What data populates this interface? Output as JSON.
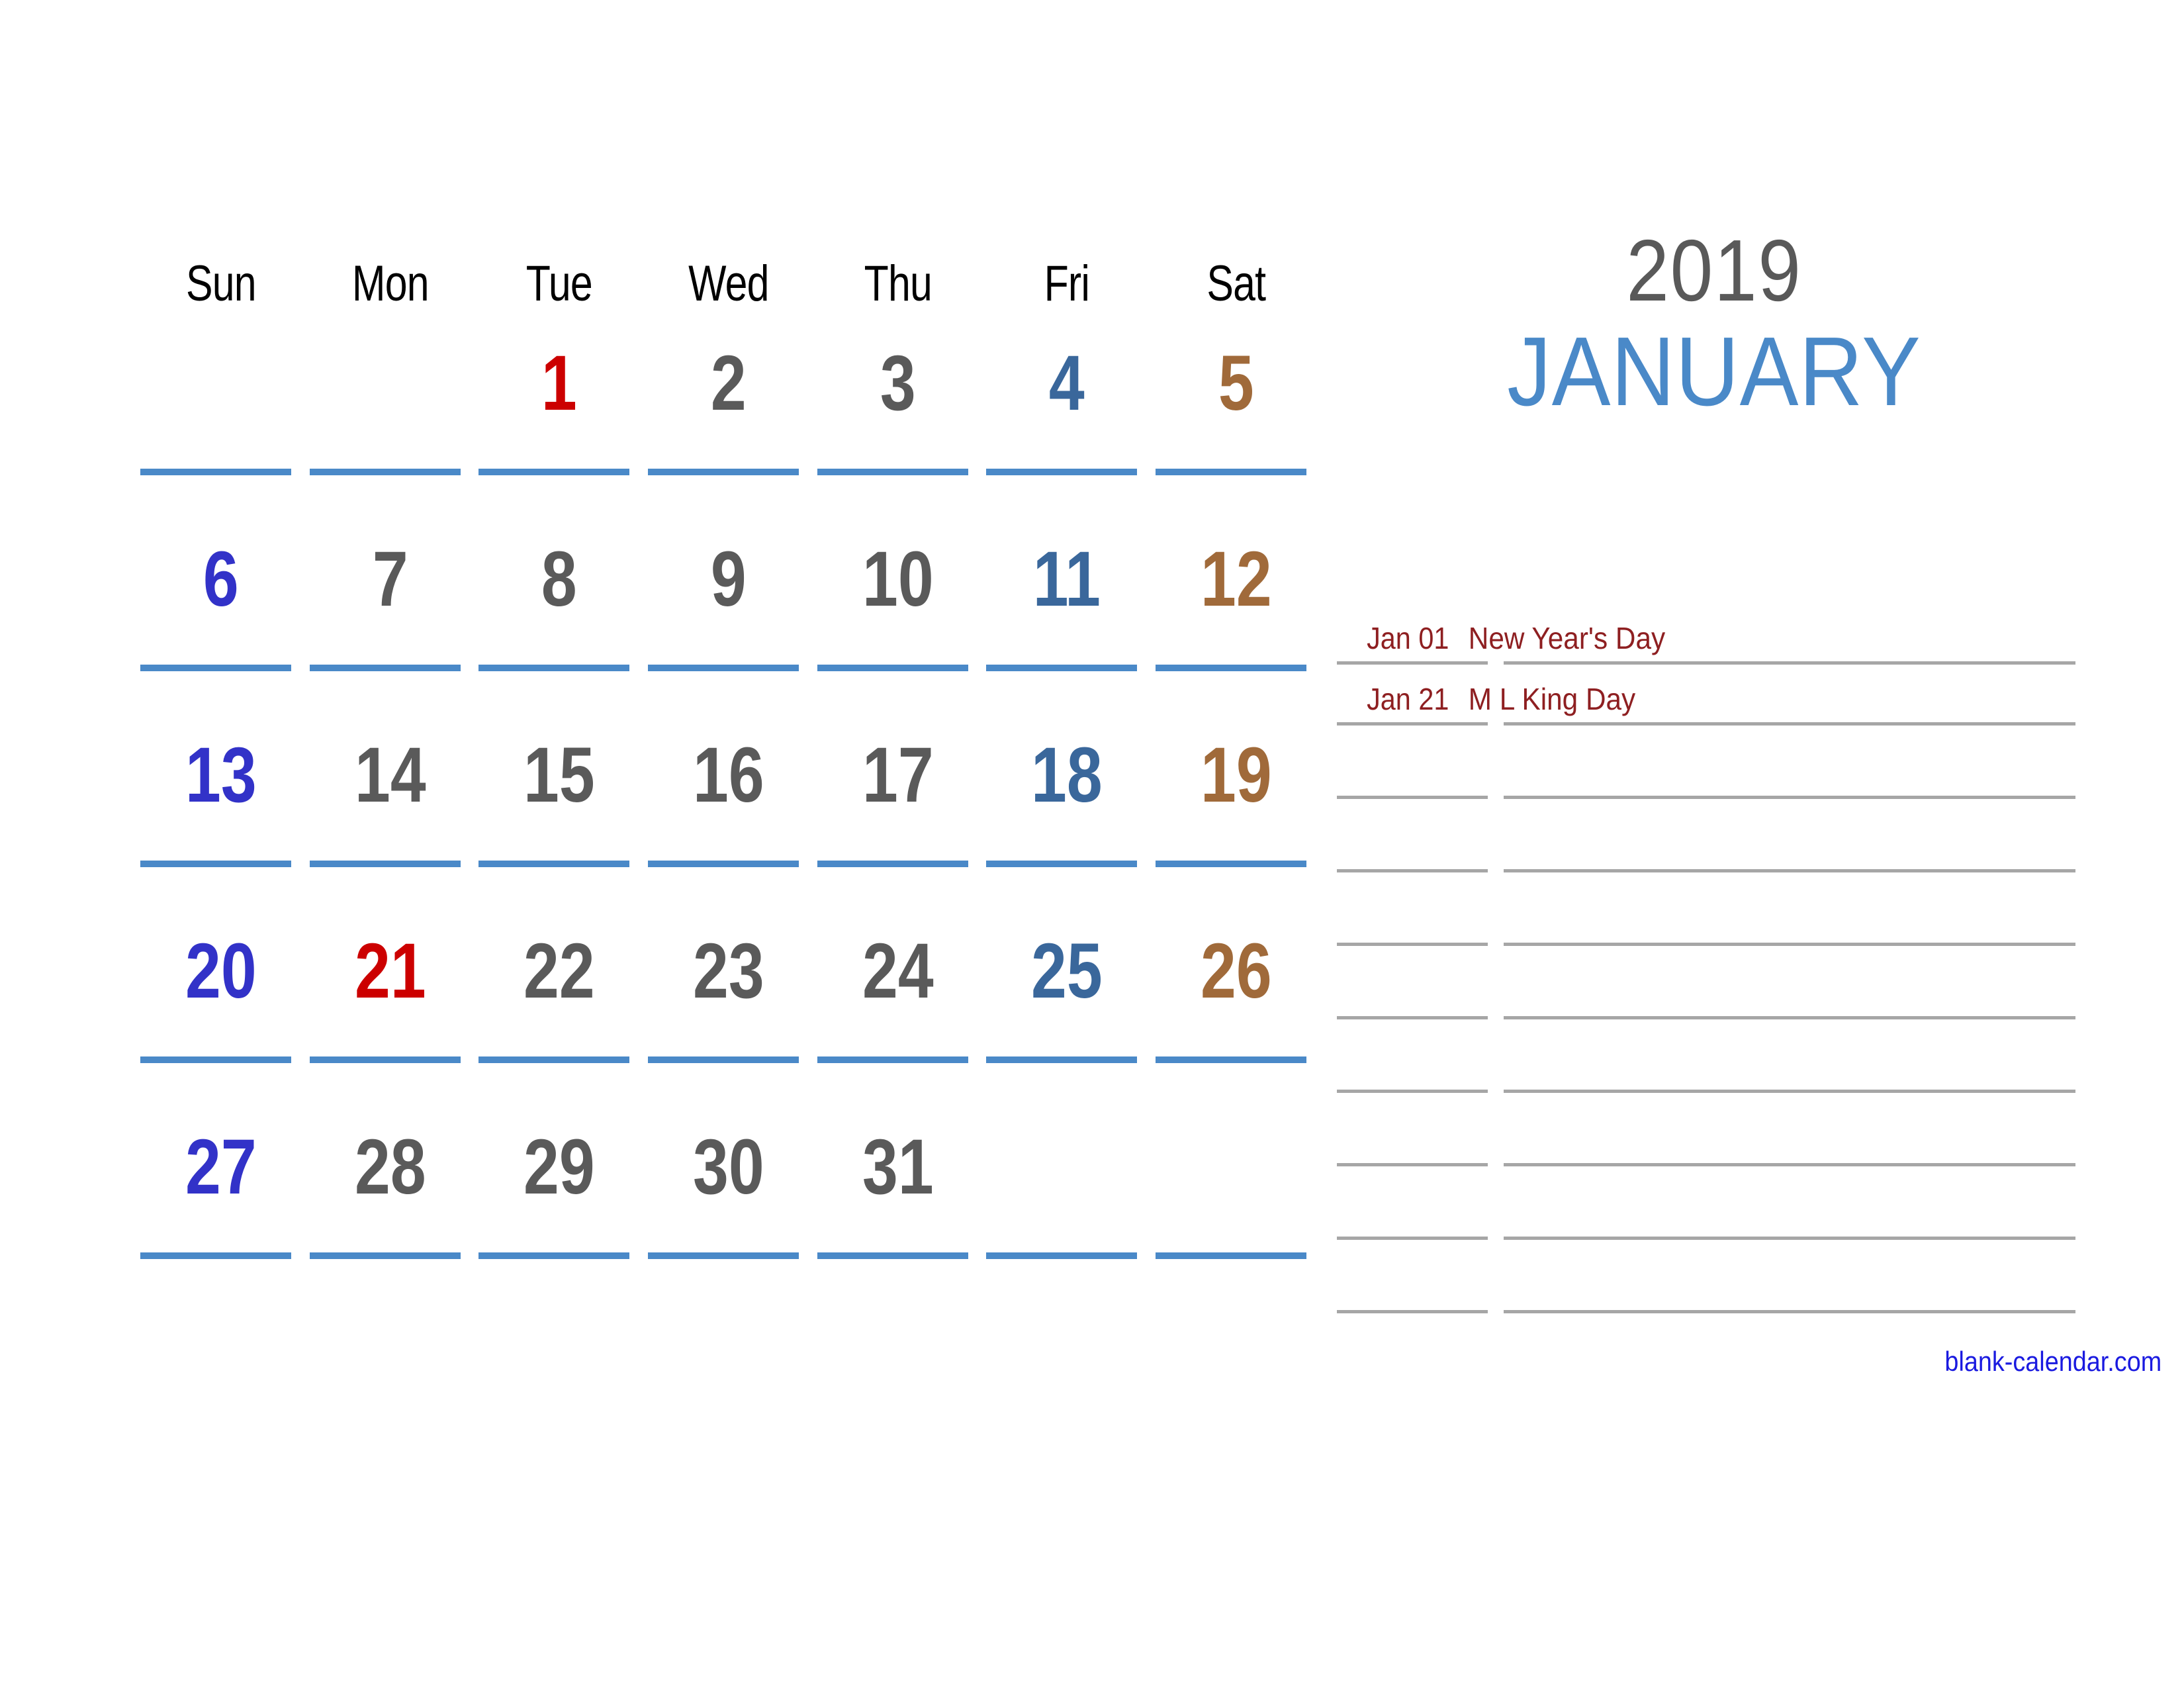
{
  "title": {
    "year": "2019",
    "month": "JANUARY"
  },
  "colors": {
    "weekday_number": "#5a5a5a",
    "sunday_number": "#3232c8",
    "friday_number": "#3a679b",
    "saturday_number": "#a06a3a",
    "holiday_number": "#cc0000",
    "row_rule": "#4a89c8",
    "month_title": "#4a89c8",
    "year_title": "#595959",
    "note_text": "#8e1f21",
    "note_rule": "#a6a6a6",
    "site_link": "#1a1ae0",
    "background": "#ffffff"
  },
  "calendar": {
    "weekday_headers": [
      "Sun",
      "Mon",
      "Tue",
      "Wed",
      "Thu",
      "Fri",
      "Sat"
    ],
    "weeks": [
      [
        {
          "label": "",
          "tone": "empty"
        },
        {
          "label": "",
          "tone": "empty"
        },
        {
          "label": "1",
          "tone": "holiday"
        },
        {
          "label": "2",
          "tone": "weekday"
        },
        {
          "label": "3",
          "tone": "weekday"
        },
        {
          "label": "4",
          "tone": "friday"
        },
        {
          "label": "5",
          "tone": "saturday"
        }
      ],
      [
        {
          "label": "6",
          "tone": "sunday"
        },
        {
          "label": "7",
          "tone": "weekday"
        },
        {
          "label": "8",
          "tone": "weekday"
        },
        {
          "label": "9",
          "tone": "weekday"
        },
        {
          "label": "10",
          "tone": "weekday"
        },
        {
          "label": "11",
          "tone": "friday"
        },
        {
          "label": "12",
          "tone": "saturday"
        }
      ],
      [
        {
          "label": "13",
          "tone": "sunday"
        },
        {
          "label": "14",
          "tone": "weekday"
        },
        {
          "label": "15",
          "tone": "weekday"
        },
        {
          "label": "16",
          "tone": "weekday"
        },
        {
          "label": "17",
          "tone": "weekday"
        },
        {
          "label": "18",
          "tone": "friday"
        },
        {
          "label": "19",
          "tone": "saturday"
        }
      ],
      [
        {
          "label": "20",
          "tone": "sunday"
        },
        {
          "label": "21",
          "tone": "holiday"
        },
        {
          "label": "22",
          "tone": "weekday"
        },
        {
          "label": "23",
          "tone": "weekday"
        },
        {
          "label": "24",
          "tone": "weekday"
        },
        {
          "label": "25",
          "tone": "friday"
        },
        {
          "label": "26",
          "tone": "saturday"
        }
      ],
      [
        {
          "label": "27",
          "tone": "sunday"
        },
        {
          "label": "28",
          "tone": "weekday"
        },
        {
          "label": "29",
          "tone": "weekday"
        },
        {
          "label": "30",
          "tone": "weekday"
        },
        {
          "label": "31",
          "tone": "weekday"
        },
        {
          "label": "",
          "tone": "empty"
        },
        {
          "label": "",
          "tone": "empty"
        }
      ]
    ]
  },
  "notes": {
    "rows": [
      {
        "date": "Jan 01",
        "text": "New Year's Day",
        "spacing": "tight"
      },
      {
        "date": "Jan 21",
        "text": "M L King Day",
        "spacing": "tight"
      },
      {
        "date": "",
        "text": "",
        "spacing": "loose"
      },
      {
        "date": "",
        "text": "",
        "spacing": "loose"
      },
      {
        "date": "",
        "text": "",
        "spacing": "loose"
      },
      {
        "date": "",
        "text": "",
        "spacing": "loose"
      },
      {
        "date": "",
        "text": "",
        "spacing": "loose"
      },
      {
        "date": "",
        "text": "",
        "spacing": "loose"
      },
      {
        "date": "",
        "text": "",
        "spacing": "loose"
      },
      {
        "date": "",
        "text": "",
        "spacing": "loose"
      }
    ]
  },
  "footer": {
    "site": "blank-calendar.com"
  }
}
